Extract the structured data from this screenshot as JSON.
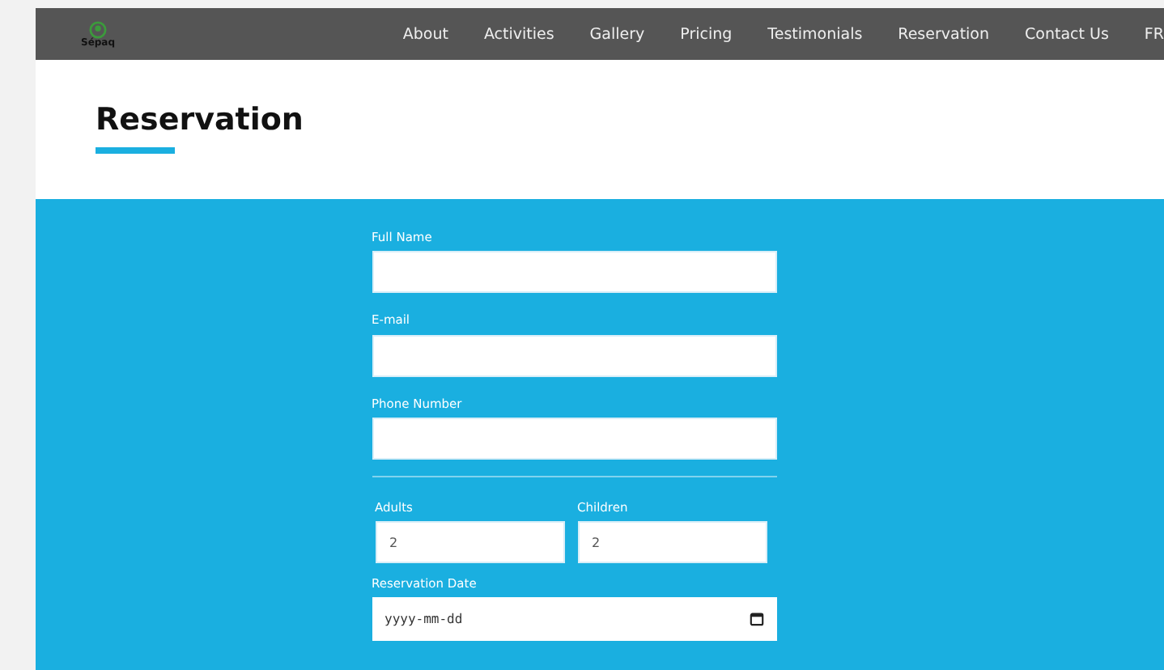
{
  "nav": {
    "logo": "Sépaq",
    "items": [
      "About",
      "Activities",
      "Gallery",
      "Pricing",
      "Testimonials",
      "Reservation",
      "Contact Us",
      "FR"
    ]
  },
  "header": {
    "title": "Reservation"
  },
  "form": {
    "fields": [
      {
        "label": "Full Name"
      },
      {
        "label": "E-mail"
      },
      {
        "label": "Phone Number"
      }
    ],
    "counts": [
      {
        "label": "Adults",
        "value": "2"
      },
      {
        "label": "Children",
        "value": "2"
      }
    ],
    "date": {
      "label": "Reservation Date",
      "placeholder": "yyyy-mm-dd"
    }
  }
}
